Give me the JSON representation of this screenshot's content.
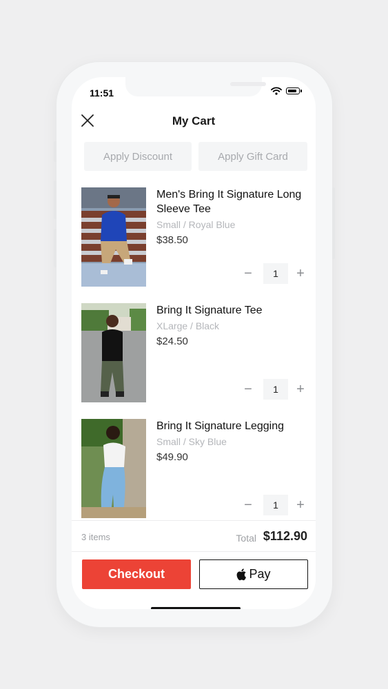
{
  "status_bar": {
    "time": "11:51"
  },
  "header": {
    "title": "My Cart"
  },
  "promos": {
    "discount_label": "Apply Discount",
    "gift_card_label": "Apply Gift Card"
  },
  "items": [
    {
      "name": "Men's Bring It Signature Long Sleeve Tee",
      "variant": "Small / Royal Blue",
      "price": "$38.50",
      "quantity": "1"
    },
    {
      "name": "Bring It Signature Tee",
      "variant": "XLarge / Black",
      "price": "$24.50",
      "quantity": "1"
    },
    {
      "name": "Bring It Signature Legging",
      "variant": "Small / Sky Blue",
      "price": "$49.90",
      "quantity": "1"
    }
  ],
  "summary": {
    "items_count": "3 items",
    "total_label": "Total",
    "total_value": "$112.90"
  },
  "actions": {
    "checkout_label": "Checkout",
    "apple_pay_label": "Pay"
  },
  "colors": {
    "accent": "#ec4336",
    "muted_text": "#b4b6ba"
  },
  "icons": [
    "close-icon",
    "wifi-icon",
    "battery-icon",
    "minus-icon",
    "plus-icon",
    "apple-logo-icon"
  ]
}
